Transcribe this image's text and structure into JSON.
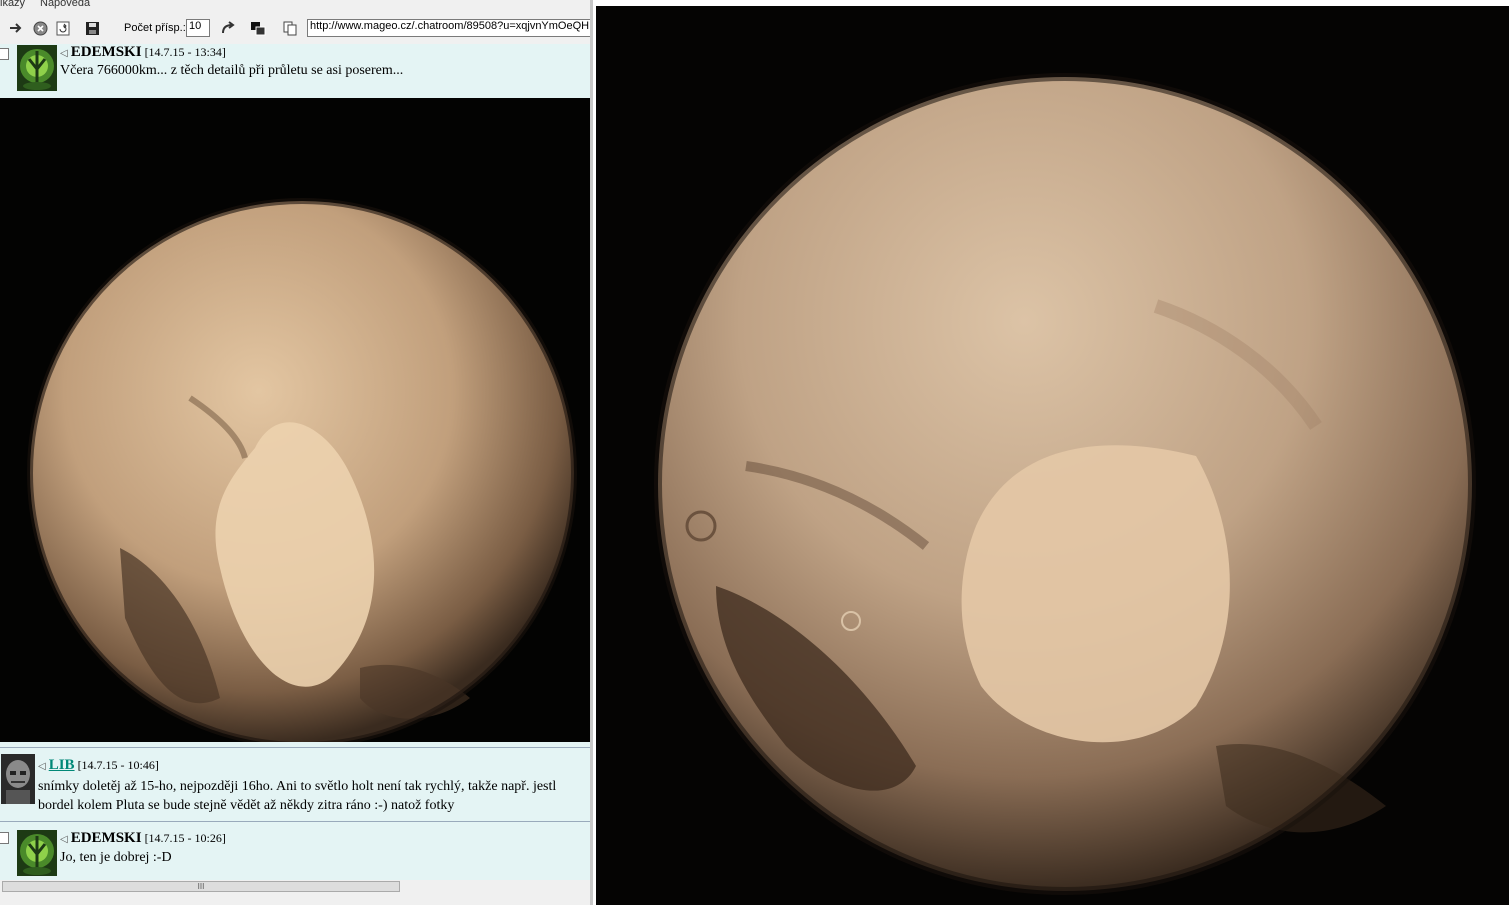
{
  "menubar": {
    "items": [
      "ikazy",
      "Nápověda"
    ]
  },
  "toolbar": {
    "count_label": "Počet přísp.:",
    "count_value": "10",
    "url": "http://www.mageo.cz/.chatroom/89508?u=xqjvnYmOeQH",
    "icons": [
      "forward-arrow-icon",
      "stop-icon",
      "refresh-icon",
      "save-icon",
      "redo-icon",
      "windows-icon",
      "copy-icon"
    ]
  },
  "messages": [
    {
      "nick": "EDEMSKI",
      "timestamp": "[14.7.15 - 13:34]",
      "text": "Včera 766000km... z těch detailů při průletu se asi poserem...",
      "has_image": true
    },
    {
      "nick": "LIB",
      "timestamp": "[14.7.15 - 10:46]",
      "text_line1": "snímky doletěj až 15-ho, nejpozději 16ho. Ani to světlo holt není tak rychlý, takže např. jestl",
      "text_line2": "bordel kolem Pluta se bude stejně vědět až někdy zitra ráno :-) natož fotky"
    },
    {
      "nick": "EDEMSKI",
      "timestamp": "[14.7.15 - 10:26]",
      "text": "Jo, ten je dobrej :-D"
    }
  ],
  "scrollbar": {
    "thumb_grip": "III"
  }
}
